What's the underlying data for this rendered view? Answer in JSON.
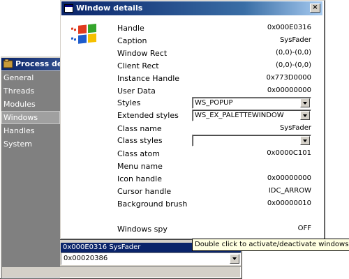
{
  "background_window": {
    "title": "Process deta",
    "nav": [
      {
        "label": "General"
      },
      {
        "label": "Threads"
      },
      {
        "label": "Modules"
      },
      {
        "label": "Windows"
      },
      {
        "label": "Handles"
      },
      {
        "label": "System"
      }
    ],
    "selected_nav": "Windows",
    "list_selected_row": "0x000E0316    SysFader",
    "combo_value": "0x00020386"
  },
  "dialog": {
    "title": "Window details",
    "close_label": "×",
    "fields": {
      "handle": {
        "label": "Handle",
        "value": "0x000E0316"
      },
      "caption": {
        "label": "Caption",
        "value": "SysFader"
      },
      "window_rect": {
        "label": "Window Rect",
        "value": "(0,0)-(0,0)"
      },
      "client_rect": {
        "label": "Client Rect",
        "value": "(0,0)-(0,0)"
      },
      "instance_handle": {
        "label": "Instance Handle",
        "value": "0x773D0000"
      },
      "user_data": {
        "label": "User Data",
        "value": "0x00000000"
      },
      "styles": {
        "label": "Styles",
        "value": "WS_POPUP"
      },
      "extended_styles": {
        "label": "Extended styles",
        "value": "WS_EX_PALETTEWINDOW"
      },
      "class_name": {
        "label": "Class name",
        "value": "SysFader"
      },
      "class_styles": {
        "label": "Class styles",
        "value": ""
      },
      "class_atom": {
        "label": "Class atom",
        "value": "0x0000C101"
      },
      "menu_name": {
        "label": "Menu name",
        "value": ""
      },
      "icon_handle": {
        "label": "Icon handle",
        "value": "0x00000000"
      },
      "cursor_handle": {
        "label": "Cursor handle",
        "value": "IDC_ARROW"
      },
      "background_brush": {
        "label": "Background brush",
        "value": "0x00000010"
      },
      "windows_spy": {
        "label": "Windows spy",
        "value": "OFF"
      }
    }
  },
  "tooltip": {
    "text": "Double click to activate/deactivate windows spy"
  },
  "colors": {
    "title_active": "#0a246a",
    "title_gradient_end": "#a6caf0",
    "face": "#d4d0c8",
    "nav_background": "#808080",
    "tooltip_background": "#ffffe1"
  },
  "icons": {
    "app_icon": "windows-flag-icon",
    "process_icon": "process-icon",
    "close_icon": "close-icon",
    "dropdown_icon": "chevron-down-icon"
  }
}
